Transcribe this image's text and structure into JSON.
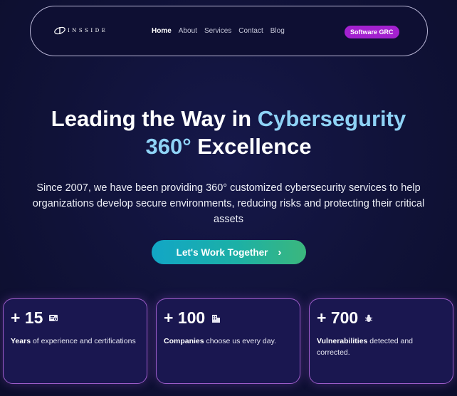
{
  "nav": {
    "logo_text": "INSSIDE",
    "links": [
      "Home",
      "About",
      "Services",
      "Contact",
      "Blog"
    ],
    "cta": "Software GRC"
  },
  "hero": {
    "title_part1": "Leading the Way in ",
    "title_accent1": "Cybersegurity",
    "title_accent2": "360°",
    "title_part2": " Excellence",
    "subtitle": "Since 2007, we have been providing 360° customized cybersecurity services to help organizations develop secure environments, reducing risks and protecting their critical assets",
    "cta": "Let's Work Together",
    "accent_color": "#8fd3f6"
  },
  "stats": [
    {
      "number": "+ 15",
      "bold": "Years",
      "rest": " of experience and certifications",
      "icon": "certificate-icon"
    },
    {
      "number": "+ 100",
      "bold": "Companies",
      "rest": " choose us every day.",
      "icon": "building-icon"
    },
    {
      "number": "+ 700",
      "bold": "Vulnerabilities",
      "rest": " detected and corrected.",
      "icon": "bug-icon"
    }
  ]
}
